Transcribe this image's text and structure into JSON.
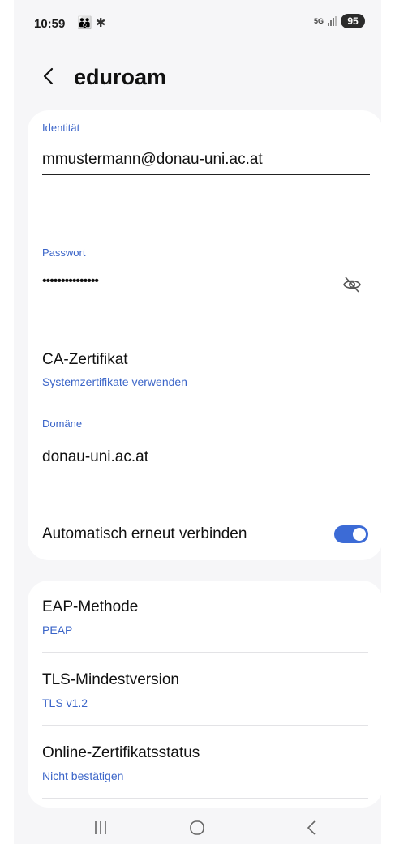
{
  "status": {
    "time": "10:59",
    "left_icons": "👪 ✱",
    "network": "5G",
    "battery": "95"
  },
  "header": {
    "title": "eduroam"
  },
  "form": {
    "identity_label": "Identität",
    "identity_value": "mmustermann@donau-uni.ac.at",
    "password_label": "Passwort",
    "password_value": "•••••••••••••••",
    "ca_title": "CA-Zertifikat",
    "ca_value": "Systemzertifikate verwenden",
    "domain_label": "Domäne",
    "domain_value": "donau-uni.ac.at",
    "auto_reconnect_label": "Automatisch erneut verbinden",
    "auto_reconnect_on": true
  },
  "advanced": {
    "items": [
      {
        "title": "EAP-Methode",
        "value": "PEAP"
      },
      {
        "title": "TLS-Mindestversion",
        "value": "TLS v1.2"
      },
      {
        "title": "Online-Zertifikatsstatus",
        "value": "Nicht bestätigen"
      }
    ]
  },
  "icons": {
    "back": "chevron-left-icon",
    "visibility": "eye-off-icon",
    "nav_recents": "recents-icon",
    "nav_home": "home-icon",
    "nav_back": "back-icon"
  },
  "colors": {
    "accent": "#3c6bd6",
    "link": "#3a64c8",
    "background": "#f6f6f8"
  }
}
